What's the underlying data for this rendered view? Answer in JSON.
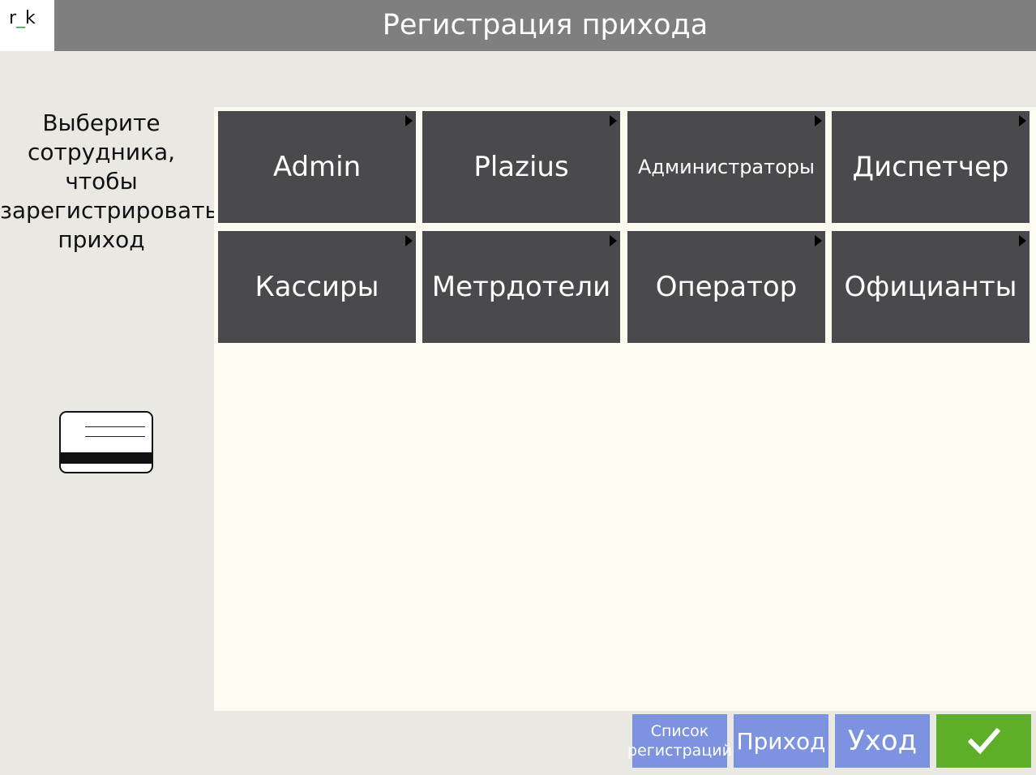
{
  "header": {
    "logo_prefix": "r",
    "logo_mid": "_",
    "logo_suffix": "k",
    "title": "Регистрация прихода"
  },
  "instruction": {
    "lines": [
      "Выберите",
      "сотрудника,",
      "чтобы",
      "зарегистрировать",
      "приход"
    ]
  },
  "employees": [
    {
      "label": "Admin"
    },
    {
      "label": "Plazius"
    },
    {
      "label": "Администраторы"
    },
    {
      "label": "Диспетчер"
    },
    {
      "label": "Кассиры"
    },
    {
      "label": "Метрдотели"
    },
    {
      "label": "Оператор"
    },
    {
      "label": "Официанты"
    }
  ],
  "footer": {
    "list_line1": "Список",
    "list_line2": "регистраций",
    "arrive_label": "Приход",
    "leave_label": "Уход",
    "ok_icon": "checkmark-icon"
  },
  "colors": {
    "topbar": "#7f7f7f",
    "background": "#e9e8e2",
    "panel": "#fbfbf2",
    "employee_button": "#4a494b",
    "action_button": "#7e93df",
    "ok_button": "#5fae2a"
  }
}
